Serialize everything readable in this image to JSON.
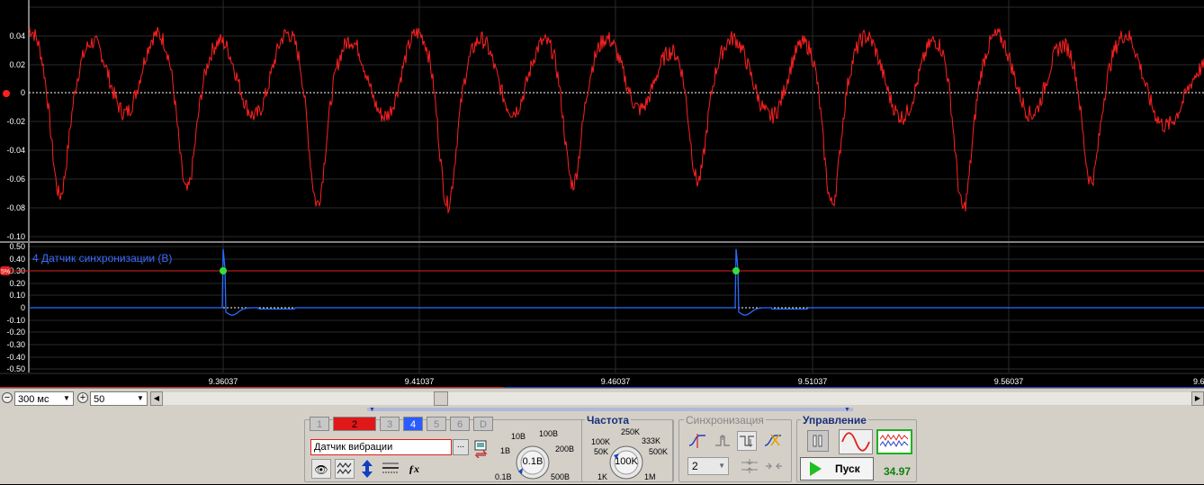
{
  "scope": {
    "top_ticks": [
      "0.04",
      "0.02",
      "0",
      "-0.02",
      "-0.04",
      "-0.06",
      "-0.08",
      "-0.10"
    ],
    "bottom_ticks": [
      "0.50",
      "0.40",
      "0.30",
      "0.20",
      "0.10",
      "0",
      "-0.10",
      "-0.20",
      "-0.30",
      "-0.40",
      "-0.50"
    ],
    "time_ticks": [
      "9.36037",
      "9.41037",
      "9.46037",
      "9.51037",
      "9.56037",
      "9.6"
    ],
    "channel_label": "4 Датчик синхронизации (В)",
    "trigger_marker": "5%",
    "trace_color_top": "#ff2020",
    "trace_color_bottom": "#2a6bff",
    "trigger_line_color": "#e02020"
  },
  "toolbar": {
    "timebase": "300 мс",
    "samples": "50"
  },
  "channels": {
    "tabs": [
      "1",
      "2",
      "3",
      "4",
      "5",
      "6",
      "D"
    ],
    "active": "2",
    "name_value": "Датчик вибрации",
    "browse_label": "...",
    "range_knob_value": "0.1В",
    "range_labels": [
      "10В",
      "100В",
      "1В",
      "200В",
      "0.1В",
      "500В"
    ]
  },
  "frequency": {
    "title": "Частота",
    "knob_value": "100K",
    "labels": [
      "250K",
      "100K",
      "333K",
      "50K",
      "500K",
      "1K",
      "1M"
    ]
  },
  "sync": {
    "title": "Синхронизация",
    "channel_select": "2"
  },
  "control": {
    "title": "Управление",
    "run_label": "Пуск",
    "counter": "34.97"
  }
}
